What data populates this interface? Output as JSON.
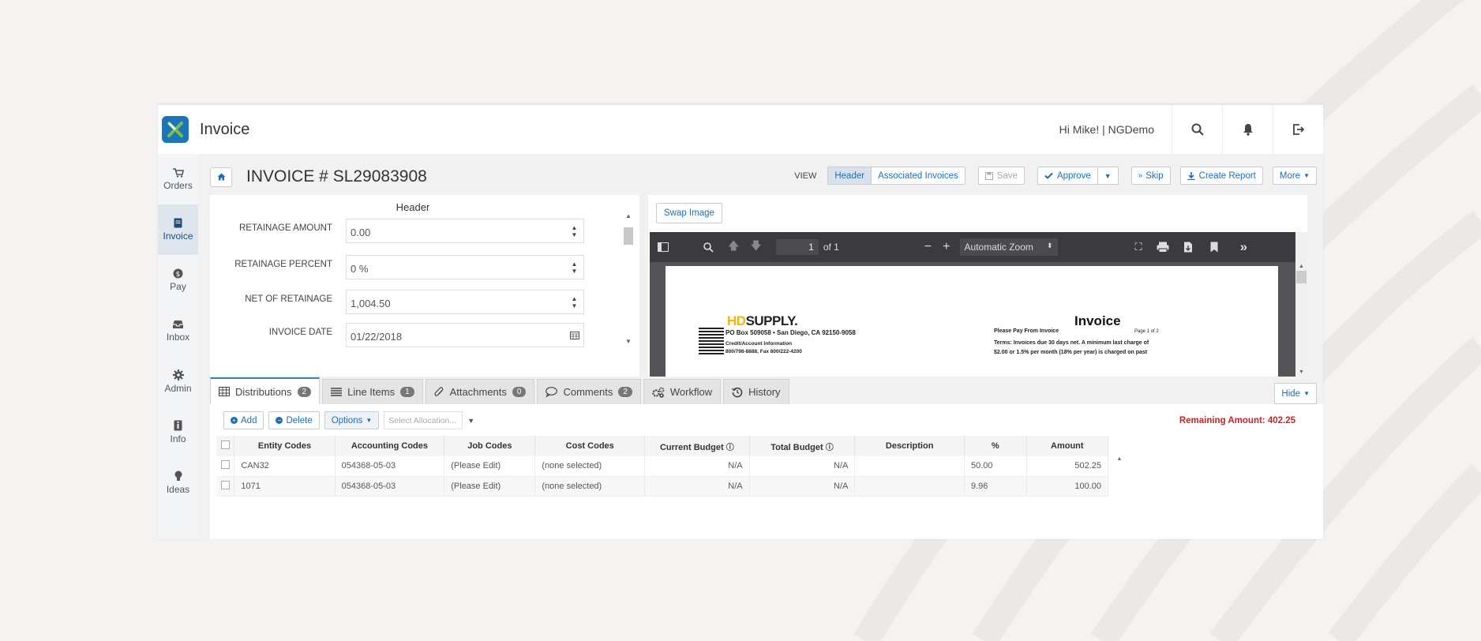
{
  "app": {
    "title": "Invoice",
    "greeting": "Hi Mike! | NGDemo"
  },
  "nav": [
    {
      "label": "Orders",
      "icon": "cart-icon"
    },
    {
      "label": "Invoice",
      "icon": "invoice-icon",
      "active": true
    },
    {
      "label": "Pay",
      "icon": "dollar-icon"
    },
    {
      "label": "Inbox",
      "icon": "inbox-icon"
    },
    {
      "label": "Admin",
      "icon": "gear-icon"
    },
    {
      "label": "Info",
      "icon": "info-icon"
    },
    {
      "label": "Ideas",
      "icon": "bulb-icon"
    }
  ],
  "header": {
    "invoice_title": "INVOICE # SL29083908",
    "view_label": "VIEW",
    "view_header": "Header",
    "view_associated": "Associated Invoices",
    "save": "Save",
    "approve": "Approve",
    "skip": "Skip",
    "create_report": "Create Report",
    "more": "More"
  },
  "form": {
    "title": "Header",
    "fields": [
      {
        "label": "RETAINAGE AMOUNT",
        "value": "0.00"
      },
      {
        "label": "RETAINAGE PERCENT",
        "value": "0 %"
      },
      {
        "label": "NET OF RETAINAGE",
        "value": "1,004.50"
      },
      {
        "label": "INVOICE DATE",
        "value": "01/22/2018"
      }
    ]
  },
  "viewer": {
    "swap_image": "Swap Image",
    "page_num": "1",
    "page_of": "of 1",
    "zoom": "Automatic Zoom",
    "doc": {
      "brand_a": "HD",
      "brand_b": "SUPPLY.",
      "address": "PO Box 509058 • San Diego, CA 92150-9058",
      "credit": "Credit/Account Information",
      "phone": "800/798-8888, Fax 800/222-4200",
      "invoice_title": "Invoice",
      "pay_from": "Please Pay From Invoice",
      "page": "Page 1 of 2",
      "terms1": "Terms: Invoices due 30 days net. A minimum last charge of",
      "terms2": "$2.00 or 1.5% per month (18% per year) is charged on past"
    }
  },
  "tabs": [
    {
      "label": "Distributions",
      "count": "2",
      "icon": "grid-icon",
      "active": true
    },
    {
      "label": "Line Items",
      "count": "1",
      "icon": "list-icon"
    },
    {
      "label": "Attachments",
      "count": "0",
      "icon": "paperclip-icon"
    },
    {
      "label": "Comments",
      "count": "2",
      "icon": "comment-icon"
    },
    {
      "label": "Workflow",
      "icon": "cogs-icon"
    },
    {
      "label": "History",
      "icon": "history-icon"
    }
  ],
  "hide": "Hide",
  "distributions": {
    "add": "Add",
    "delete": "Delete",
    "options": "Options",
    "allocation_placeholder": "Select Allocation...",
    "remaining": "Remaining Amount: 402.25",
    "columns": [
      "Entity Codes",
      "Accounting Codes",
      "Job Codes",
      "Cost Codes",
      "Current Budget",
      "Total Budget",
      "Description",
      "%",
      "Amount"
    ],
    "rows": [
      [
        "CAN32",
        "054368-05-03",
        "(Please Edit)",
        "(none selected)",
        "N/A",
        "N/A",
        "",
        "50.00",
        "502.25"
      ],
      [
        "1071",
        "054368-05-03",
        "(Please Edit)",
        "(none selected)",
        "N/A",
        "N/A",
        "",
        "9.96",
        "100.00"
      ]
    ]
  },
  "colors": {
    "accent": "#1c6fb7",
    "danger": "#c0262d",
    "pdf_toolbar": "#3b3b3f"
  }
}
